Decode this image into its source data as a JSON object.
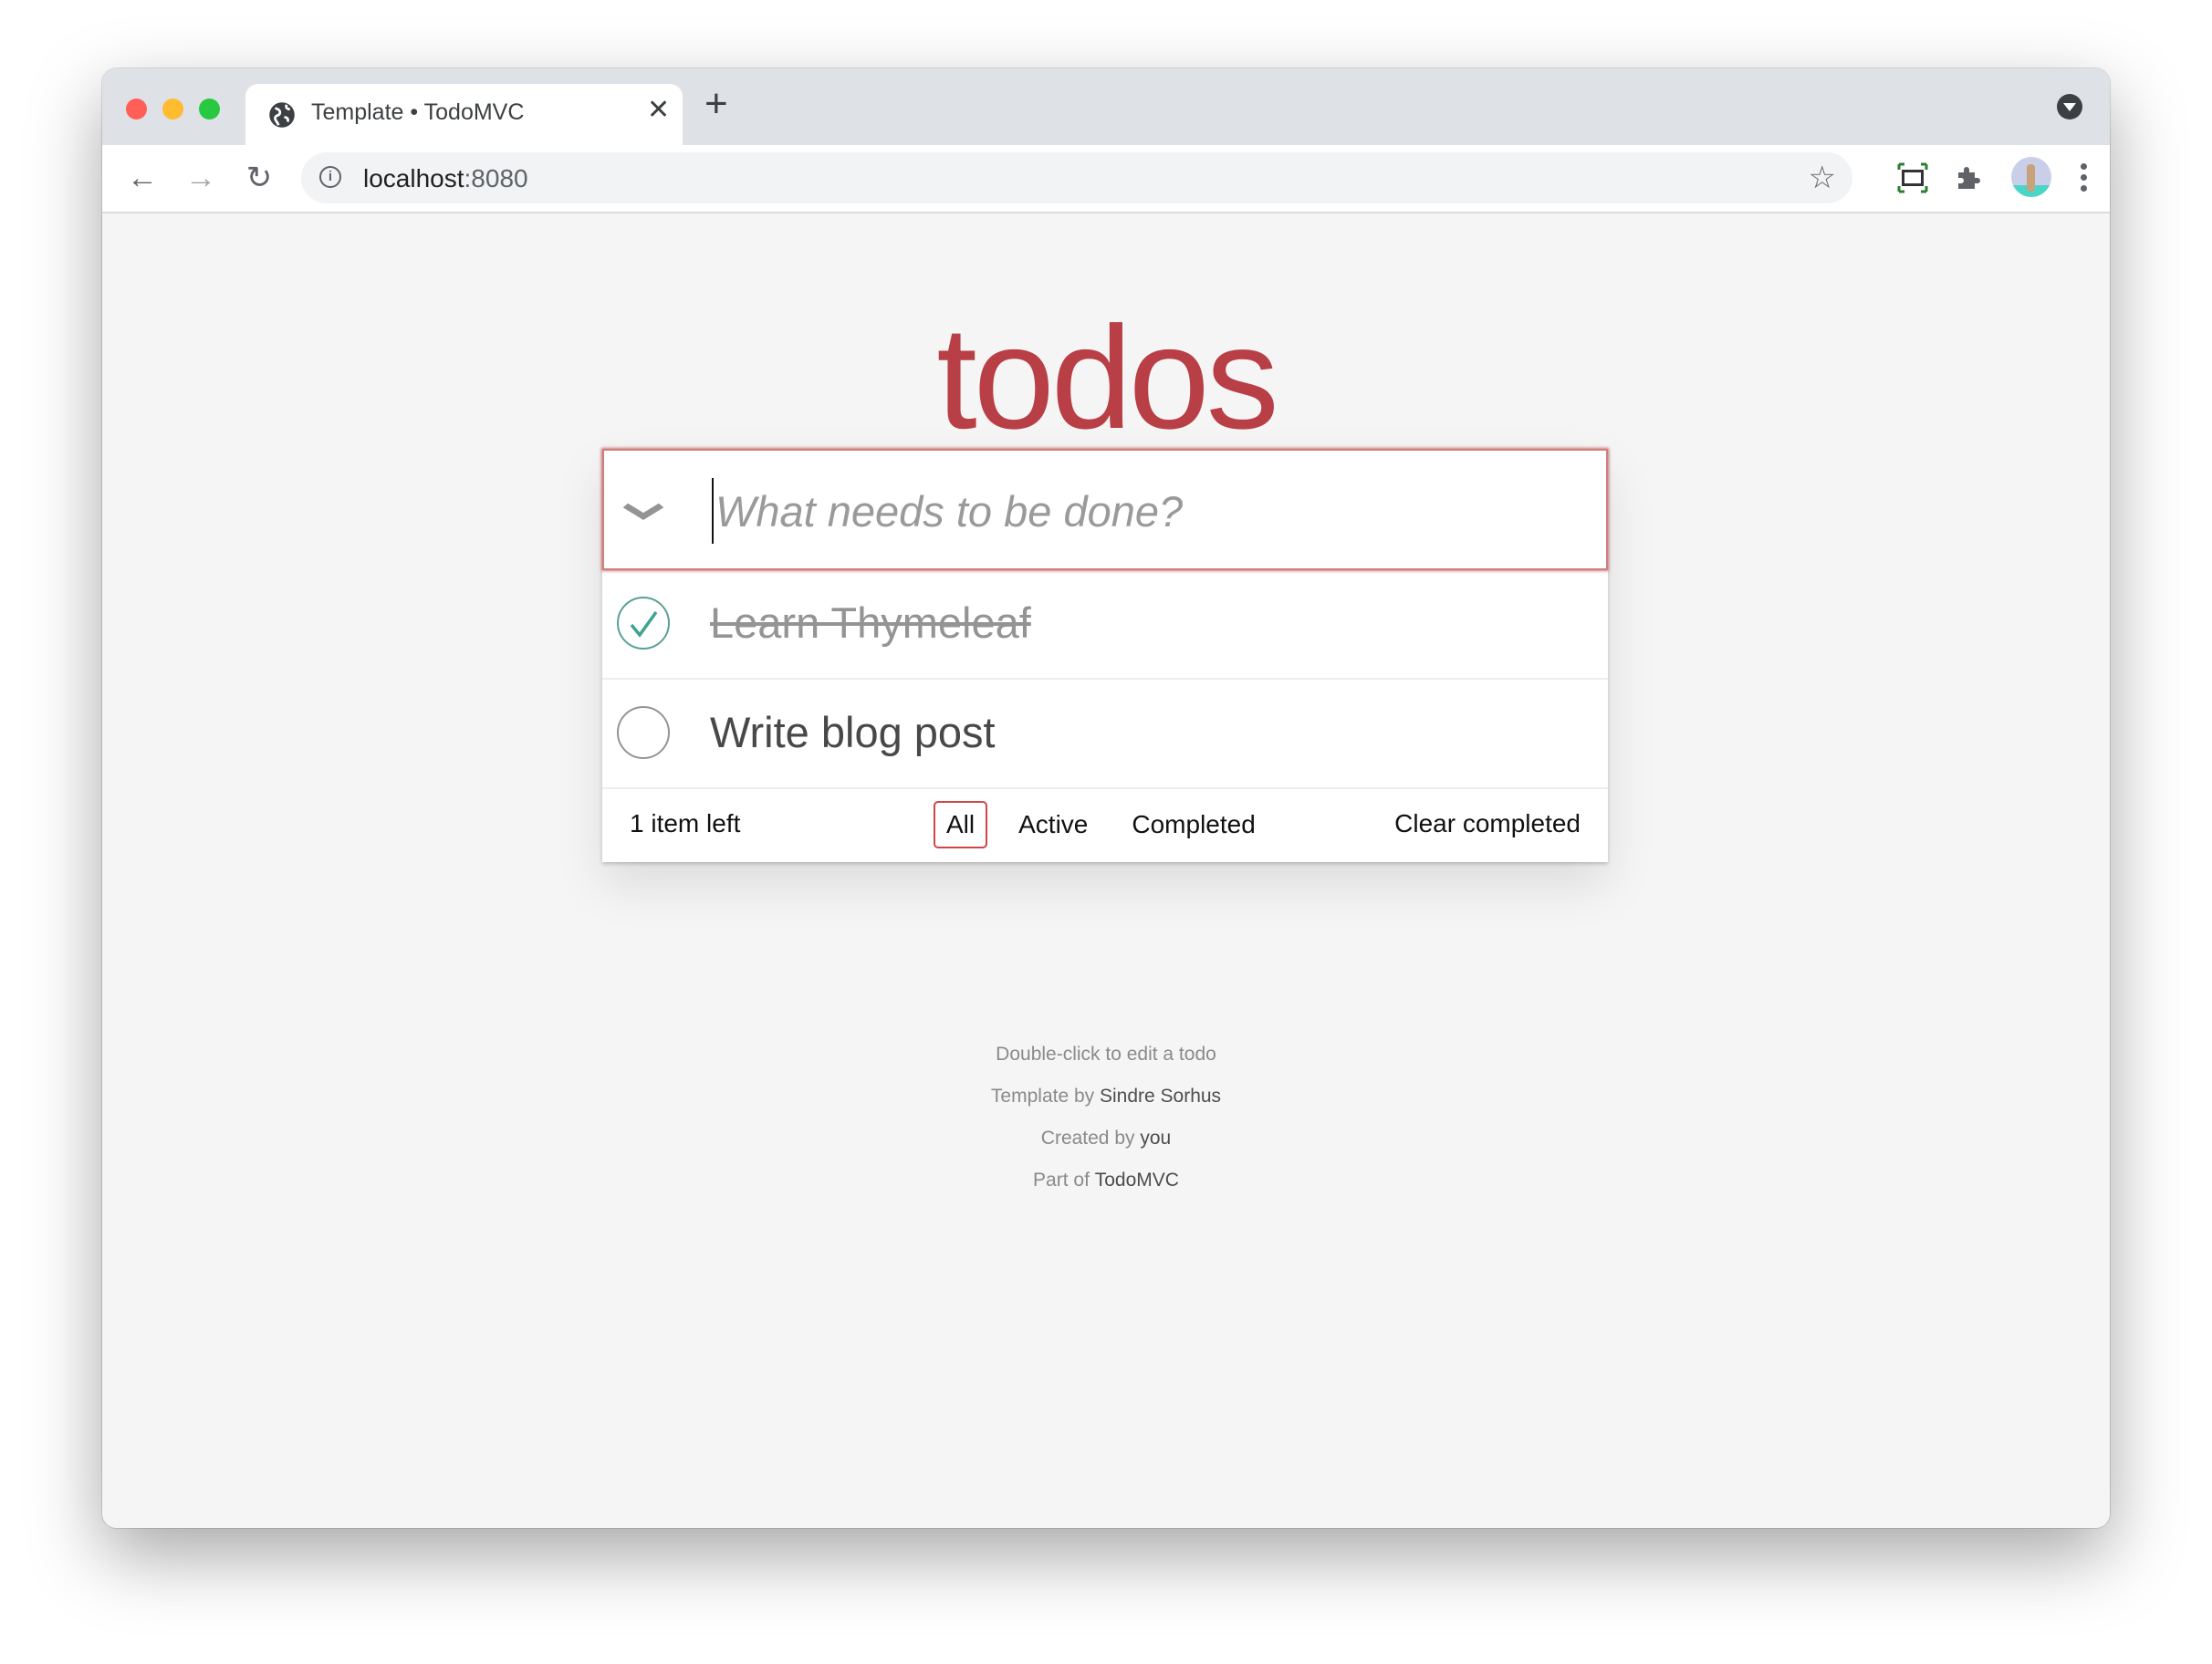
{
  "browser": {
    "tab_title": "Template • TodoMVC",
    "tab_close": "✕",
    "new_tab": "+",
    "url_host": "localhost",
    "url_port": ":8080",
    "nav": {
      "back": "←",
      "forward": "→",
      "reload": "↻"
    },
    "star": "☆",
    "traffic_lights": {
      "close": "#ff5f57",
      "minimize": "#febc2e",
      "maximize": "#28c840"
    }
  },
  "app": {
    "title": "todos",
    "input_placeholder": "What needs to be done?",
    "toggle_all": "❯",
    "todos": [
      {
        "label": "Learn Thymeleaf",
        "completed": true
      },
      {
        "label": "Write blog post",
        "completed": false
      }
    ],
    "footer": {
      "count": "1 item left",
      "filters": [
        {
          "label": "All",
          "selected": true
        },
        {
          "label": "Active",
          "selected": false
        },
        {
          "label": "Completed",
          "selected": false
        }
      ],
      "clear_completed": "Clear completed"
    },
    "accent": "#b83f45"
  },
  "info": {
    "hint": "Double-click to edit a todo",
    "template_by_prefix": "Template by ",
    "template_by_name": "Sindre Sorhus",
    "created_by_prefix": "Created by ",
    "created_by_name": "you",
    "part_of_prefix": "Part of ",
    "part_of_name": "TodoMVC"
  }
}
